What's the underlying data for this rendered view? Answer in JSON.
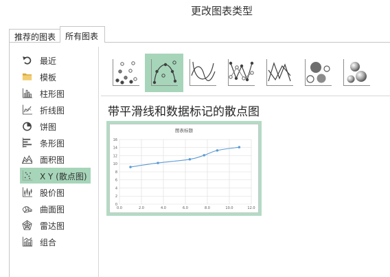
{
  "window": {
    "title": "更改图表类型"
  },
  "tabs": [
    {
      "label": "推荐的图表",
      "active": false
    },
    {
      "label": "所有图表",
      "active": true
    }
  ],
  "sidebar": {
    "selected_index": 7,
    "items": [
      {
        "label": "最近",
        "icon": "recent-icon"
      },
      {
        "label": "模板",
        "icon": "folder-icon"
      },
      {
        "label": "柱形图",
        "icon": "column-chart-icon"
      },
      {
        "label": "折线图",
        "icon": "line-chart-icon"
      },
      {
        "label": "饼图",
        "icon": "pie-chart-icon"
      },
      {
        "label": "条形图",
        "icon": "bar-chart-icon"
      },
      {
        "label": "面积图",
        "icon": "area-chart-icon"
      },
      {
        "label": "X Y (散点图)",
        "icon": "scatter-chart-icon"
      },
      {
        "label": "股价图",
        "icon": "stock-chart-icon"
      },
      {
        "label": "曲面图",
        "icon": "surface-chart-icon"
      },
      {
        "label": "雷达图",
        "icon": "radar-chart-icon"
      },
      {
        "label": "组合",
        "icon": "combo-chart-icon"
      }
    ]
  },
  "subtypes": {
    "selected_index": 1,
    "items": [
      {
        "icon": "scatter-markers-icon"
      },
      {
        "icon": "scatter-smooth-lines-markers-icon"
      },
      {
        "icon": "scatter-smooth-lines-icon"
      },
      {
        "icon": "scatter-straight-lines-markers-icon"
      },
      {
        "icon": "scatter-straight-lines-icon"
      },
      {
        "icon": "bubble-icon"
      },
      {
        "icon": "3d-bubble-icon"
      }
    ]
  },
  "preview": {
    "heading": "带平滑线和数据标记的散点图"
  },
  "colors": {
    "selection": "#a6d5ba",
    "frame": "#b3dbc4",
    "series": "#5b9bd5",
    "gridline": "#d9d9d9"
  },
  "chart_data": {
    "type": "scatter",
    "smooth": true,
    "markers": true,
    "title": "图表标题",
    "xlabel": "",
    "ylabel": "",
    "xlim": [
      0,
      12
    ],
    "ylim": [
      0,
      16
    ],
    "xticks": [
      "0.0",
      "2.0",
      "4.0",
      "6.0",
      "8.0",
      "10.0",
      "12.0"
    ],
    "yticks": [
      "0",
      "2",
      "4",
      "6",
      "8",
      "10",
      "12",
      "14",
      "16"
    ],
    "grid": true,
    "legend": false,
    "series": [
      {
        "x": [
          1,
          3.5,
          6.4,
          7.7,
          8.9,
          10.9
        ],
        "y": [
          9.2,
          10.2,
          11.1,
          12.1,
          13.3,
          14.1
        ]
      }
    ]
  }
}
